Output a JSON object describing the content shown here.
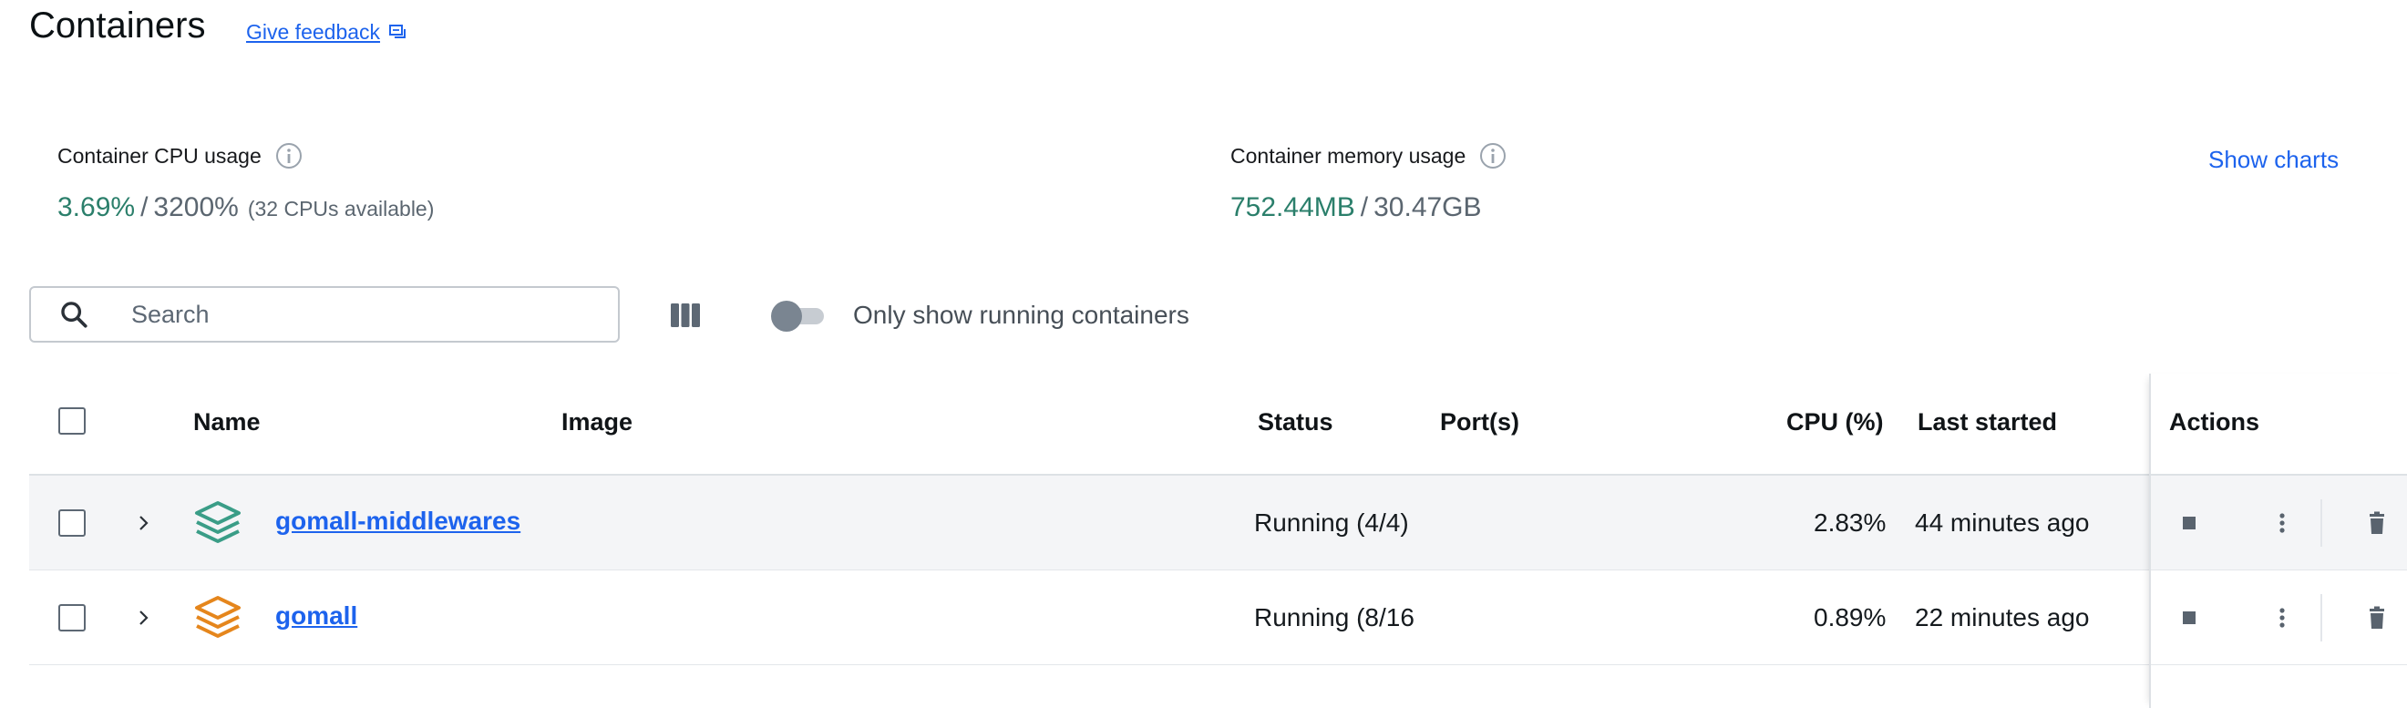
{
  "header": {
    "title": "Containers",
    "feedback_label": "Give feedback"
  },
  "metrics": {
    "cpu": {
      "label": "Container CPU usage",
      "used": "3.69%",
      "separator": "/",
      "total": "3200%",
      "available": "(32 CPUs available)"
    },
    "memory": {
      "label": "Container memory usage",
      "used": "752.44MB",
      "separator": "/",
      "total": "30.47GB"
    },
    "show_charts_label": "Show charts"
  },
  "toolbar": {
    "search_placeholder": "Search",
    "search_value": "",
    "running_toggle_label": "Only show running containers",
    "running_toggle_on": false
  },
  "table": {
    "columns": {
      "name": "Name",
      "image": "Image",
      "status": "Status",
      "ports": "Port(s)",
      "cpu": "CPU (%)",
      "last_started": "Last started",
      "actions": "Actions"
    },
    "rows": [
      {
        "name": "gomall-middlewares",
        "image": "",
        "status": "Running (4/4)",
        "ports": "",
        "cpu": "2.83%",
        "last_started": "44 minutes ago",
        "icon_color": "#3a9d87"
      },
      {
        "name": "gomall",
        "image": "",
        "status": "Running (8/16",
        "ports": "",
        "cpu": "0.89%",
        "last_started": "22 minutes ago",
        "icon_color": "#e5861c"
      }
    ]
  },
  "colors": {
    "accent": "#1d63ed",
    "metric_used": "#2b7f6b",
    "text_muted": "#5b6670"
  },
  "icons": {
    "feedback": "feedback-icon",
    "info": "info-icon",
    "search": "search-icon",
    "columns": "columns-icon",
    "chevron": "chevron-right-icon",
    "stack": "stack-icon",
    "stop": "stop-icon",
    "more": "more-vertical-icon",
    "delete": "trash-icon"
  }
}
